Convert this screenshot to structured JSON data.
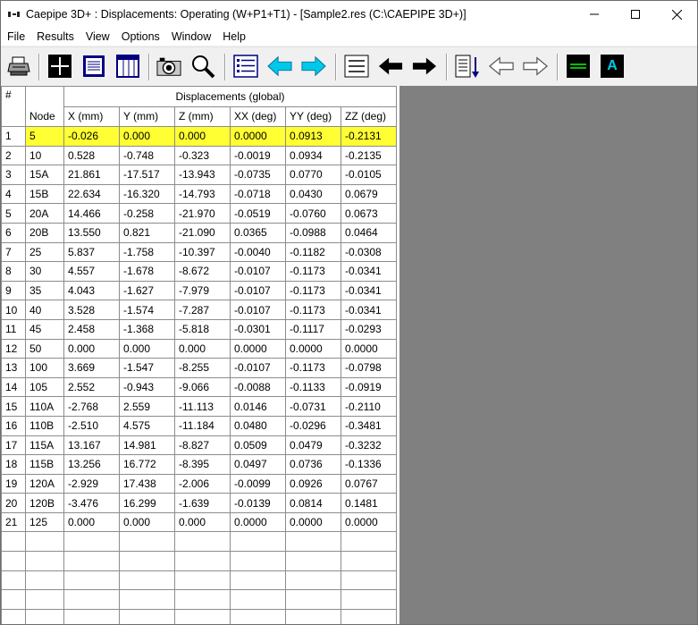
{
  "window": {
    "title": "Caepipe 3D+ : Displacements: Operating (W+P1+T1) -  [Sample2.res (C:\\CAEPIPE 3D+)]",
    "controls": [
      "minimize-icon",
      "maximize-icon",
      "close-icon"
    ]
  },
  "menu": {
    "items": [
      {
        "label": "File"
      },
      {
        "label": "Results"
      },
      {
        "label": "View"
      },
      {
        "label": "Options"
      },
      {
        "label": "Window"
      },
      {
        "label": "Help"
      }
    ]
  },
  "toolbar": {
    "icons": [
      "printer-icon",
      "node-grid-icon",
      "text-view-icon",
      "list-view-icon",
      "camera-icon",
      "zoom-icon",
      "list-icon",
      "previous-arrow-icon",
      "next-arrow-icon",
      "menu-lines-icon",
      "back-arrow-icon",
      "forward-arrow-icon",
      "sort-down-icon",
      "outline-left-arrow-icon",
      "outline-right-arrow-icon",
      "line-color-icon",
      "text-color-icon"
    ],
    "text_color_glyph": "A",
    "accent_cyan": "#00c8e8",
    "green": "#00c000"
  },
  "grid": {
    "hash_label": "#",
    "group_header": "Displacements (global)",
    "columns": [
      "Node",
      "X (mm)",
      "Y (mm)",
      "Z (mm)",
      "XX (deg)",
      "YY (deg)",
      "ZZ (deg)"
    ],
    "selected_row": 1,
    "selected_color": "#ffff33",
    "rows": [
      {
        "n": "1",
        "cells": [
          "5",
          "-0.026",
          "0.000",
          "0.000",
          "0.0000",
          "0.0913",
          "-0.2131"
        ]
      },
      {
        "n": "2",
        "cells": [
          "10",
          "0.528",
          "-0.748",
          "-0.323",
          "-0.0019",
          "0.0934",
          "-0.2135"
        ]
      },
      {
        "n": "3",
        "cells": [
          "15A",
          "21.861",
          "-17.517",
          "-13.943",
          "-0.0735",
          "0.0770",
          "-0.0105"
        ]
      },
      {
        "n": "4",
        "cells": [
          "15B",
          "22.634",
          "-16.320",
          "-14.793",
          "-0.0718",
          "0.0430",
          "0.0679"
        ]
      },
      {
        "n": "5",
        "cells": [
          "20A",
          "14.466",
          "-0.258",
          "-21.970",
          "-0.0519",
          "-0.0760",
          "0.0673"
        ]
      },
      {
        "n": "6",
        "cells": [
          "20B",
          "13.550",
          "0.821",
          "-21.090",
          "0.0365",
          "-0.0988",
          "0.0464"
        ]
      },
      {
        "n": "7",
        "cells": [
          "25",
          "5.837",
          "-1.758",
          "-10.397",
          "-0.0040",
          "-0.1182",
          "-0.0308"
        ]
      },
      {
        "n": "8",
        "cells": [
          "30",
          "4.557",
          "-1.678",
          "-8.672",
          "-0.0107",
          "-0.1173",
          "-0.0341"
        ]
      },
      {
        "n": "9",
        "cells": [
          "35",
          "4.043",
          "-1.627",
          "-7.979",
          "-0.0107",
          "-0.1173",
          "-0.0341"
        ]
      },
      {
        "n": "10",
        "cells": [
          "40",
          "3.528",
          "-1.574",
          "-7.287",
          "-0.0107",
          "-0.1173",
          "-0.0341"
        ]
      },
      {
        "n": "11",
        "cells": [
          "45",
          "2.458",
          "-1.368",
          "-5.818",
          "-0.0301",
          "-0.1117",
          "-0.0293"
        ]
      },
      {
        "n": "12",
        "cells": [
          "50",
          "0.000",
          "0.000",
          "0.000",
          "0.0000",
          "0.0000",
          "0.0000"
        ]
      },
      {
        "n": "13",
        "cells": [
          "100",
          "3.669",
          "-1.547",
          "-8.255",
          "-0.0107",
          "-0.1173",
          "-0.0798"
        ]
      },
      {
        "n": "14",
        "cells": [
          "105",
          "2.552",
          "-0.943",
          "-9.066",
          "-0.0088",
          "-0.1133",
          "-0.0919"
        ]
      },
      {
        "n": "15",
        "cells": [
          "110A",
          "-2.768",
          "2.559",
          "-11.113",
          "0.0146",
          "-0.0731",
          "-0.2110"
        ]
      },
      {
        "n": "16",
        "cells": [
          "110B",
          "-2.510",
          "4.575",
          "-11.184",
          "0.0480",
          "-0.0296",
          "-0.3481"
        ]
      },
      {
        "n": "17",
        "cells": [
          "115A",
          "13.167",
          "14.981",
          "-8.827",
          "0.0509",
          "0.0479",
          "-0.3232"
        ]
      },
      {
        "n": "18",
        "cells": [
          "115B",
          "13.256",
          "16.772",
          "-8.395",
          "0.0497",
          "0.0736",
          "-0.1336"
        ]
      },
      {
        "n": "19",
        "cells": [
          "120A",
          "-2.929",
          "17.438",
          "-2.006",
          "-0.0099",
          "0.0926",
          "0.0767"
        ]
      },
      {
        "n": "20",
        "cells": [
          "120B",
          "-3.476",
          "16.299",
          "-1.639",
          "-0.0139",
          "0.0814",
          "0.1481"
        ]
      },
      {
        "n": "21",
        "cells": [
          "125",
          "0.000",
          "0.000",
          "0.000",
          "0.0000",
          "0.0000",
          "0.0000"
        ]
      }
    ],
    "empty_rows": 5
  }
}
